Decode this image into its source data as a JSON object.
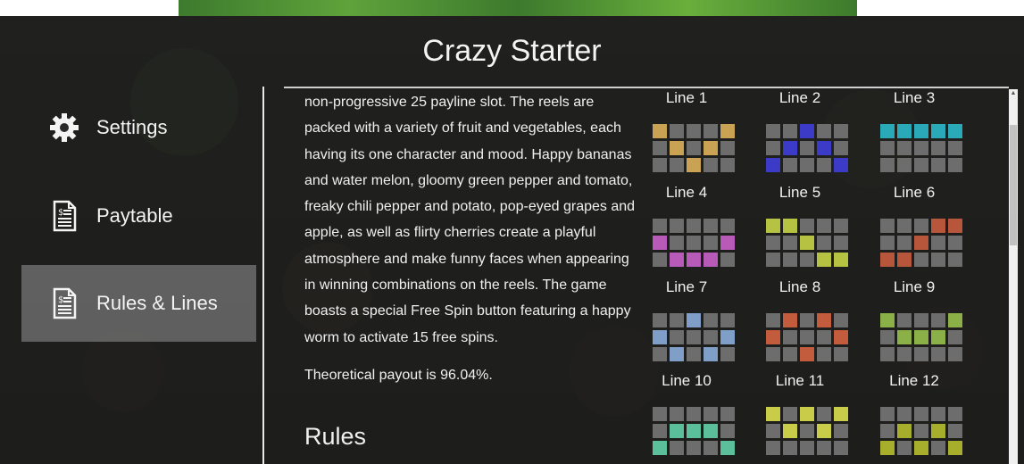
{
  "title": "Crazy Starter",
  "sidebar": {
    "items": [
      {
        "label": "Settings",
        "icon": "gear-icon",
        "active": false
      },
      {
        "label": "Paytable",
        "icon": "paytable-document-icon",
        "active": false
      },
      {
        "label": "Rules & Lines",
        "icon": "rules-document-icon",
        "active": true
      }
    ]
  },
  "content": {
    "description": "non-progressive 25 payline slot. The reels are packed with a variety of fruit and vegetables, each having its one character and mood. Happy bananas and water melon, gloomy green pepper and tomato, freaky chili pepper and potato, pop-eyed grapes and apple, as well as flirty cherries create a playful atmosphere and make funny faces when appearing in winning combinations on the reels. The game boasts a special Free Spin button featuring a happy worm to activate 15 free spins.",
    "payout": "Theoretical payout is 96.04%.",
    "rules_heading": "Rules"
  },
  "paylines": [
    {
      "label": "Line 1",
      "color": "#c9a253",
      "rows": [
        0,
        1,
        2,
        1,
        0
      ]
    },
    {
      "label": "Line 2",
      "color": "#3b3bc8",
      "rows": [
        2,
        1,
        0,
        1,
        2
      ]
    },
    {
      "label": "Line 3",
      "color": "#2aa9b8",
      "rows": [
        0,
        0,
        0,
        0,
        0
      ]
    },
    {
      "label": "Line 4",
      "color": "#b85ab8",
      "rows": [
        1,
        2,
        2,
        2,
        1
      ]
    },
    {
      "label": "Line 5",
      "color": "#b6c242",
      "rows": [
        0,
        0,
        1,
        2,
        2
      ]
    },
    {
      "label": "Line 6",
      "color": "#b8563c",
      "rows": [
        2,
        2,
        1,
        0,
        0
      ]
    },
    {
      "label": "Line 7",
      "color": "#7f9fc8",
      "rows": [
        1,
        2,
        0,
        2,
        1
      ]
    },
    {
      "label": "Line 8",
      "color": "#c25c3c",
      "rows": [
        1,
        0,
        2,
        0,
        1
      ]
    },
    {
      "label": "Line 9",
      "color": "#8cb048",
      "rows": [
        0,
        1,
        1,
        1,
        0
      ]
    },
    {
      "label": "Line 10",
      "color": "#5cbf9c",
      "rows": [
        2,
        1,
        1,
        1,
        2
      ]
    },
    {
      "label": "Line 11",
      "color": "#c8cc48",
      "rows": [
        0,
        1,
        0,
        1,
        0
      ]
    },
    {
      "label": "Line 12",
      "color": "#a6ae2c",
      "rows": [
        2,
        1,
        2,
        1,
        2
      ]
    }
  ],
  "colors": {
    "overlay": "#1c1c1c",
    "cell_off": "#6d6d6d",
    "active_nav": "#8a8a8a"
  }
}
